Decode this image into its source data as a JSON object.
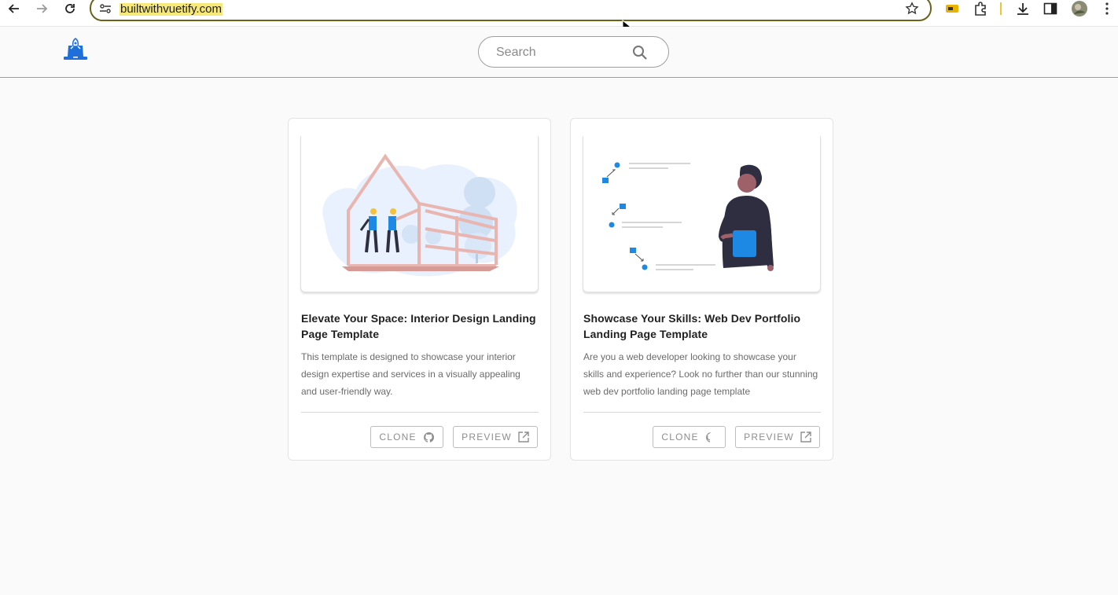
{
  "browser": {
    "url": "builtwithvuetify.com"
  },
  "header": {
    "search": {
      "placeholder": "Search",
      "value": ""
    }
  },
  "cards": [
    {
      "title": "Elevate Your Space: Interior Design Landing Page Template",
      "description": "This template is designed to showcase your interior design expertise and services in a visually appealing and user-friendly way.",
      "clone_label": "CLONE",
      "preview_label": "PREVIEW",
      "illustration": "construction-workers-house-frame"
    },
    {
      "title": "Showcase Your Skills: Web Dev Portfolio Landing Page Template",
      "description": "Are you a web developer looking to showcase your skills and experience? Look no further than our stunning web dev portfolio landing page template",
      "clone_label": "CLONE",
      "preview_label": "PREVIEW",
      "illustration": "person-with-diagram"
    }
  ],
  "colors": {
    "accent": "#1e6fd9",
    "url_highlight": "#f7e87a",
    "address_border": "#6b6319"
  }
}
